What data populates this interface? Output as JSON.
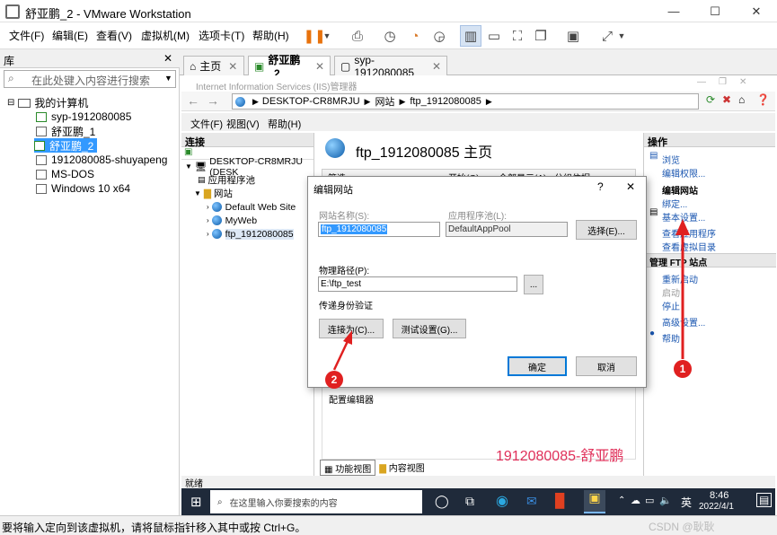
{
  "window": {
    "title": "舒亚鹏_2 - VMware Workstation"
  },
  "menu": {
    "items": [
      "文件(F)",
      "编辑(E)",
      "查看(V)",
      "虚拟机(M)",
      "选项卡(T)",
      "帮助(H)"
    ]
  },
  "library": {
    "title": "库",
    "search_placeholder": "在此处键入内容进行搜索",
    "root": "我的计算机",
    "vms": [
      "syp-1912080085",
      "舒亚鹏_1",
      "舒亚鹏_2",
      "1912080085-shuyapeng",
      "MS-DOS",
      "Windows 10 x64"
    ]
  },
  "tabs": [
    {
      "label": "主页"
    },
    {
      "label": "舒亚鹏_2"
    },
    {
      "label": "syp-1912080085"
    }
  ],
  "iis": {
    "title": "Internet Information Services (IIS)管理器",
    "breadcrumb": [
      "DESKTOP-CR8MRJU",
      "网站",
      "ftp_1912080085"
    ],
    "menu": [
      "文件(F)",
      "视图(V)",
      "帮助(H)"
    ],
    "connections_title": "连接",
    "tree": {
      "server": "DESKTOP-CR8MRJU (DESK",
      "app_pools": "应用程序池",
      "sites": "网站",
      "site_list": [
        "Default Web Site",
        "MyWeb",
        "ftp_1912080085"
      ]
    },
    "home_title": "ftp_1912080085 主页",
    "filter_label": "筛选:",
    "filter_go": "开始(G)",
    "filter_showall": "全部显示(A)",
    "filter_group": "分组依据:",
    "config_editor": "配置编辑器",
    "view_tabs": [
      "功能视图",
      "内容视图"
    ],
    "actions_title": "操作",
    "actions": {
      "browse": "浏览",
      "edit_perms": "编辑权限...",
      "edit_site_section": "编辑网站",
      "bindings": "绑定...",
      "basic_settings": "基本设置...",
      "view_apps": "查看应用程序",
      "view_vdirs": "查看虚拟目录",
      "manage_ftp_section": "管理 FTP 站点",
      "restart": "重新启动",
      "start": "启动",
      "stop": "停止",
      "advanced": "高级设置...",
      "help": "帮助"
    },
    "status": "就绪"
  },
  "dialog": {
    "title": "编辑网站",
    "help": "?",
    "site_name_label": "网站名称(S):",
    "site_name_value": "ftp_1912080085",
    "app_pool_label": "应用程序池(L):",
    "app_pool_value": "DefaultAppPool",
    "select_btn": "选择(E)...",
    "physical_path_label": "物理路径(P):",
    "physical_path_value": "E:\\ftp_test",
    "browse_btn": "...",
    "pass_auth_label": "传递身份验证",
    "connect_as_btn": "连接为(C)...",
    "test_settings_btn": "测试设置(G)...",
    "ok_btn": "确定",
    "cancel_btn": "取消"
  },
  "taskbar": {
    "search_placeholder": "在这里输入你要搜索的内容",
    "ime": "英",
    "time": "8:46",
    "date": "2022/4/1"
  },
  "annotations": {
    "marker1": "1",
    "marker2": "2",
    "watermark": "1912080085-舒亚鹏"
  },
  "bottom_status": "要将输入定向到该虚拟机，请将鼠标指针移入其中或按 Ctrl+G。",
  "csdn": "CSDN @耿耿"
}
